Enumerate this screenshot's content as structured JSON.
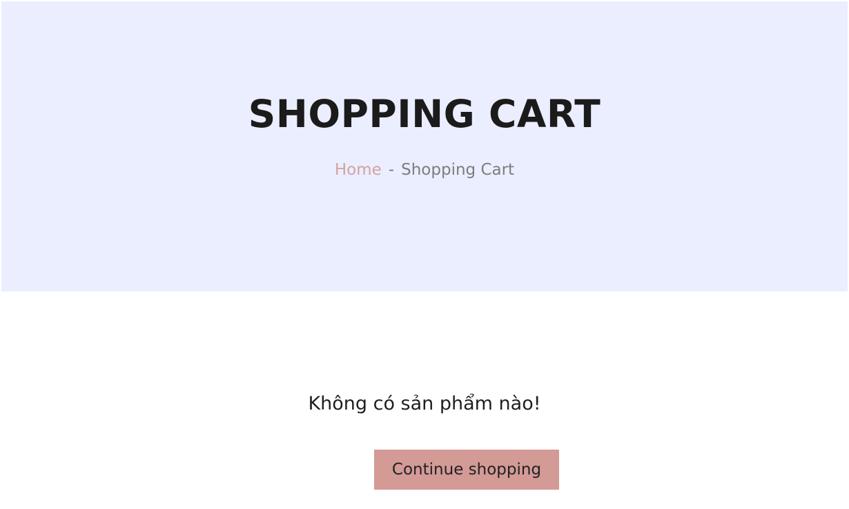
{
  "hero": {
    "title": "SHOPPING CART",
    "background_color": "#ebeeff"
  },
  "breadcrumb": {
    "home_label": "Home",
    "separator": "-",
    "current_label": "Shopping Cart",
    "link_color": "#d3a3a0"
  },
  "cart": {
    "empty_message": "Không có sản phẩm nào!",
    "continue_button_label": "Continue shopping",
    "button_color": "#d39a96"
  }
}
